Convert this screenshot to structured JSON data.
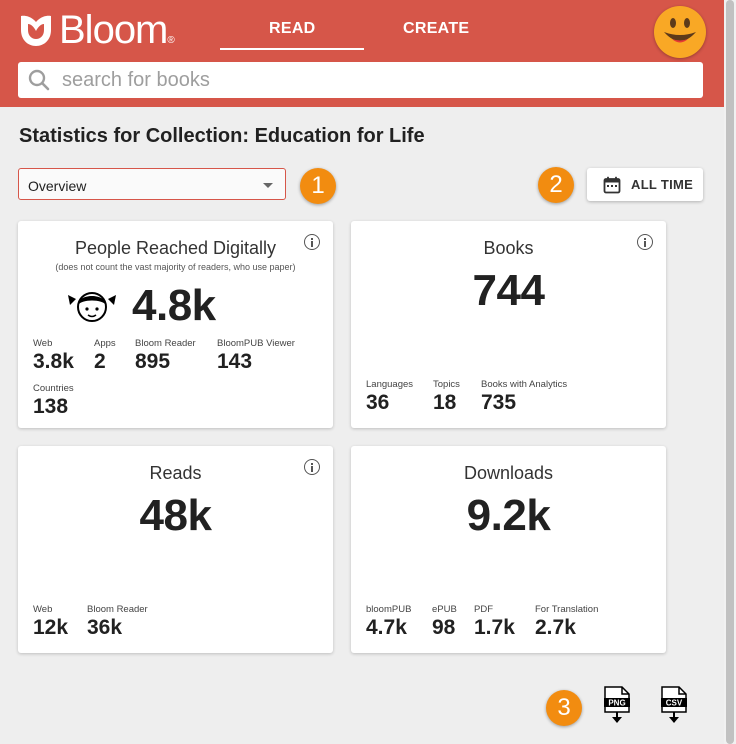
{
  "header": {
    "logo_text": "Bloom",
    "logo_reg": "®",
    "tabs": [
      {
        "label": "READ",
        "active": true
      },
      {
        "label": "CREATE",
        "active": false
      }
    ],
    "accent_color": "#d65649"
  },
  "search": {
    "placeholder": "search for books",
    "value": ""
  },
  "page": {
    "title": "Statistics for Collection: Education for Life",
    "view_select": {
      "value": "Overview"
    },
    "time_range": {
      "label": "ALL TIME",
      "icon": "calendar-icon"
    },
    "callouts": [
      "1",
      "2",
      "3"
    ],
    "callout_color": "#f28c10"
  },
  "cards": {
    "people": {
      "title": "People Reached Digitally",
      "subtitle": "(does not count the vast majority of readers, who use paper)",
      "total": "4.8k",
      "stats": [
        {
          "label": "Web",
          "value": "3.8k"
        },
        {
          "label": "Apps",
          "value": "2"
        },
        {
          "label": "Bloom Reader",
          "value": "895"
        },
        {
          "label": "BloomPUB Viewer",
          "value": "143"
        },
        {
          "label": "Countries",
          "value": "138"
        }
      ]
    },
    "books": {
      "title": "Books",
      "total": "744",
      "stats": [
        {
          "label": "Languages",
          "value": "36"
        },
        {
          "label": "Topics",
          "value": "18"
        },
        {
          "label": "Books with Analytics",
          "value": "735"
        }
      ]
    },
    "reads": {
      "title": "Reads",
      "total": "48k",
      "stats": [
        {
          "label": "Web",
          "value": "12k"
        },
        {
          "label": "Bloom Reader",
          "value": "36k"
        }
      ]
    },
    "downloads": {
      "title": "Downloads",
      "total": "9.2k",
      "stats": [
        {
          "label": "bloomPUB",
          "value": "4.7k"
        },
        {
          "label": "ePUB",
          "value": "98"
        },
        {
          "label": "PDF",
          "value": "1.7k"
        },
        {
          "label": "For Translation",
          "value": "2.7k"
        }
      ]
    }
  },
  "export": {
    "png_label": "PNG",
    "csv_label": "CSV"
  }
}
